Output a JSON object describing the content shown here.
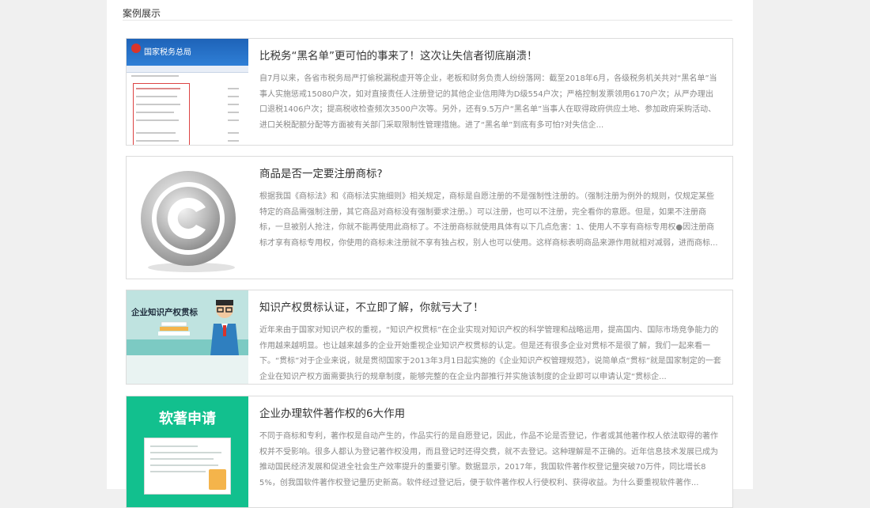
{
  "section": {
    "title": "案例展示"
  },
  "cards": [
    {
      "title": "比税务“黑名单”更可怕的事来了！这次让失信者彻底崩溃！",
      "desc": "自7月以来，各省市税务局严打偷税漏税虚开等企业，老板和财务负责人纷纷落网：截至2018年6月，各级税务机关共对“黑名单”当事人实施惩戒15080户次，如对直接责任人注册登记的其他企业信用降为D级554户次；严格控制发票领用6170户次；从严办理出口退税1406户次；提高税收检查频次3500户次等。另外，还有9.5万户“黑名单”当事人在取得政府供应土地、参加政府采购活动、进口关税配额分配等方面被有关部门采取限制性管理措施。进了“黑名单”到底有多可怕?对失信企...",
      "thumb_text": "国家税务总局"
    },
    {
      "title": "商品是否一定要注册商标?",
      "desc": "根据我国《商标法》和《商标法实施细则》相关规定，商标是自愿注册的不是强制性注册的。（强制注册为例外的规则，仅规定某些特定的商品需强制注册，其它商品对商标没有强制要求注册。）可以注册，也可以不注册，完全看你的意愿。但是，如果不注册商标，一旦被别人抢注，你就不能再使用此商标了。不注册商标就使用具体有以下几点危害：1、使用人不享有商标专用权●因注册商标才享有商标专用权，你使用的商标未注册就不享有独占权，别人也可以使用。这样商标表明商品来源作用就相对减弱，进而商标..."
    },
    {
      "title": "知识产权贯标认证，不立即了解，你就亏大了！",
      "desc": "近年来由于国家对知识产权的重视，“知识产权贯标”在企业实现对知识产权的科学管理和战略运用，提高国内、国际市场竞争能力的作用越来越明显。也让越来越多的企业开始重视企业知识产权贯标的认定。但是还有很多企业对贯标不是很了解，我们一起来看一下。“贯标”对于企业来说，就是贯彻国家于2013年3月1日起实施的《企业知识产权管理规范》，说简单点“贯标”就是国家制定的一套企业在知识产权方面需要执行的规章制度，能够完整的在企业内部推行并实施该制度的企业即可以申请认定“贯标企...",
      "thumb_text": "企业知识产权贯标"
    },
    {
      "title": "企业办理软件著作权的6大作用",
      "desc": "不同于商标和专利，著作权是自动产生的，作品实行的是自愿登记，因此，作品不论是否登记，作者或其他著作权人依法取得的著作权并不受影响。很多人都认为登记著作权没用，而且登记时还得交费，就不去登记。这种理解是不正确的。近年信息技术发展已成为推动国民经济发展和促进全社会生产效率提升的重要引擎。数据显示，2017年，我国软件著作权登记量突破70万件，同比增长85%，创我国软件著作权登记量历史新高。软件经过登记后，便于软件著作权人行使权利、获得收益。为什么要重视软件著作...",
      "thumb_text": "软著申请"
    }
  ],
  "colors": {
    "background": "#f0f0f0",
    "panel": "#ffffff",
    "card_border": "#dcdcdc",
    "title_text": "#333333",
    "desc_text": "#888888",
    "tax_blue": "#1e63b8",
    "ip_teal": "#bfe3e0",
    "software_green": "#12c08e"
  }
}
